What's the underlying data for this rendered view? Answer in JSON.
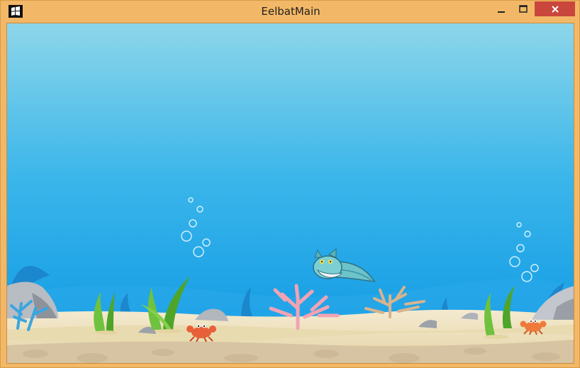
{
  "window": {
    "title": "EelbatMain",
    "app_icon": "game-icon",
    "controls": [
      "minimize-icon",
      "maximize-icon",
      "close-icon"
    ]
  },
  "colors": {
    "frame": "#f3b867",
    "close": "#c9463d",
    "water_top": "#8fd6ea",
    "water_bottom": "#0a98e6",
    "sand": "#eee1b4",
    "rock_bed": "#d9c7a6"
  },
  "scene": {
    "player": "eelbat-sprite",
    "creatures": [
      "crab-sprite",
      "crab-sprite"
    ],
    "decor": [
      "coral",
      "seaweed",
      "rocks",
      "bubbles"
    ]
  }
}
